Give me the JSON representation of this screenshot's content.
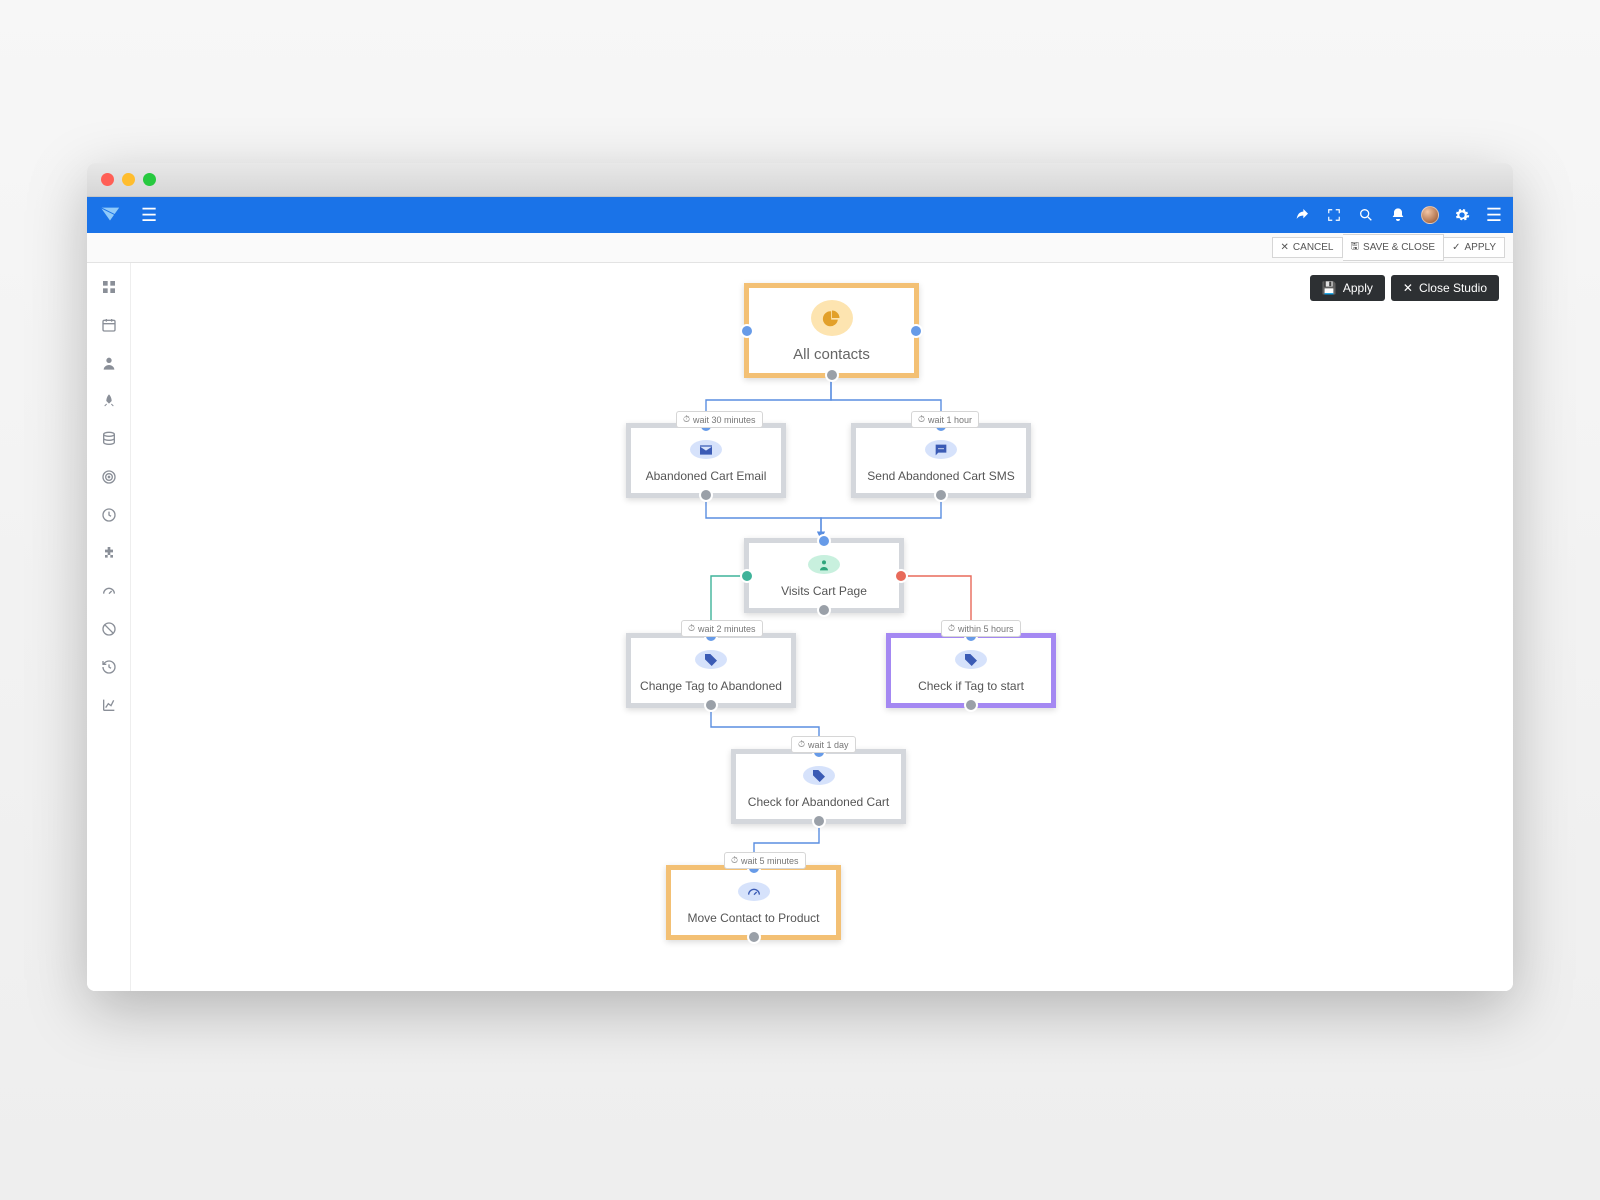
{
  "actionStrip": {
    "cancel": "CANCEL",
    "saveClose": "SAVE & CLOSE",
    "apply": "APPLY"
  },
  "studio": {
    "apply": "Apply",
    "close": "Close Studio"
  },
  "nodes": {
    "allContacts": "All contacts",
    "emailNode": "Abandoned Cart Email",
    "smsNode": "Send Abandoned Cart SMS",
    "visitsCart": "Visits Cart Page",
    "changeTag": "Change Tag to Abandoned",
    "checkTagStart": "Check if Tag to start",
    "checkAbandoned": "Check for Abandoned Cart",
    "moveContact": "Move Contact to Product"
  },
  "waits": {
    "w1": "wait 30 minutes",
    "w2": "wait 1 hour",
    "w3": "wait 2 minutes",
    "w4": "within 5 hours",
    "w5": "wait 1 day",
    "w6": "wait 5 minutes"
  }
}
